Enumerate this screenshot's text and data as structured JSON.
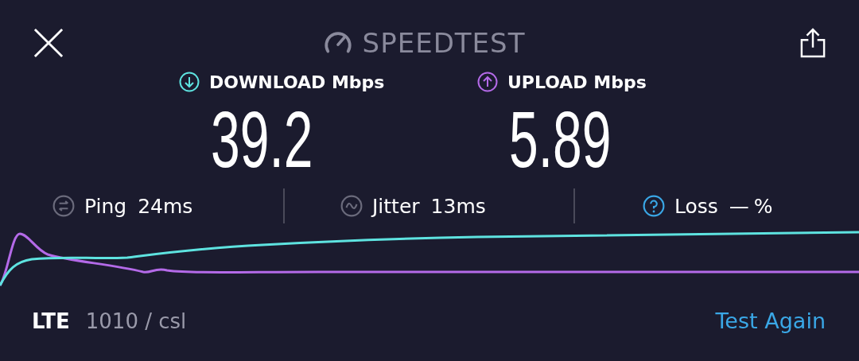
{
  "header": {
    "title": "SPEEDTEST"
  },
  "results": [
    {
      "kind": "download",
      "label": "DOWNLOAD Mbps",
      "value": "39.2"
    },
    {
      "kind": "upload",
      "label": "UPLOAD Mbps",
      "value": "5.89"
    }
  ],
  "stats": [
    {
      "kind": "ping",
      "label": "Ping",
      "value": "24ms"
    },
    {
      "kind": "jitter",
      "label": "Jitter",
      "value": "13ms"
    },
    {
      "kind": "loss",
      "label": "Loss",
      "value": "—",
      "unit": "%"
    }
  ],
  "footer": {
    "network": "LTE",
    "provider": "1010 / csl",
    "action": "Test Again"
  }
}
